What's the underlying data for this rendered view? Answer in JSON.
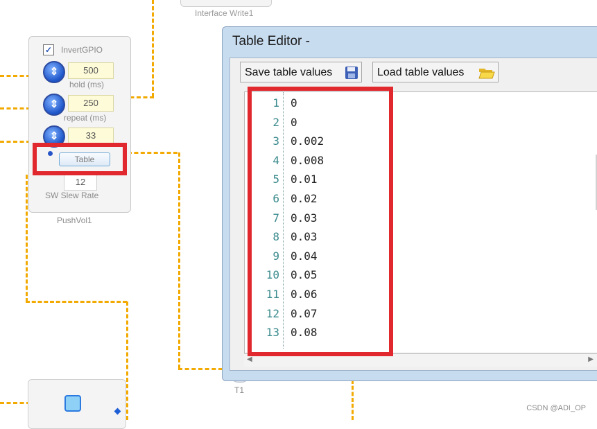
{
  "top_block_label": "Interface Write1",
  "push_block": {
    "checkbox_label": "InvertGPIO",
    "checkbox_checked": true,
    "hold_value": "500",
    "hold_label": "hold (ms)",
    "repeat_value": "250",
    "repeat_label": "repeat (ms)",
    "third_value": "33",
    "table_button": "Table",
    "slew_value": "12",
    "slew_label": "SW Slew Rate",
    "block_name": "PushVol1"
  },
  "t1_label": "T1",
  "dialog": {
    "title": "Table Editor -",
    "save_button": "Save table values",
    "load_button": "Load table values",
    "rows": [
      {
        "line": "1",
        "value": "0"
      },
      {
        "line": "2",
        "value": "0"
      },
      {
        "line": "3",
        "value": "0.002"
      },
      {
        "line": "4",
        "value": "0.008"
      },
      {
        "line": "5",
        "value": "0.01"
      },
      {
        "line": "6",
        "value": "0.02"
      },
      {
        "line": "7",
        "value": "0.03"
      },
      {
        "line": "8",
        "value": "0.03"
      },
      {
        "line": "9",
        "value": "0.04"
      },
      {
        "line": "10",
        "value": "0.05"
      },
      {
        "line": "11",
        "value": "0.06"
      },
      {
        "line": "12",
        "value": "0.07"
      },
      {
        "line": "13",
        "value": "0.08"
      }
    ]
  },
  "watermark": "CSDN @ADI_OP",
  "colors": {
    "wire": "#f2a900",
    "highlight": "#e0282e",
    "line_number": "#3a8a8c"
  },
  "icons": [
    "save-icon",
    "folder-open-icon",
    "knob-icon",
    "checkbox-icon"
  ]
}
